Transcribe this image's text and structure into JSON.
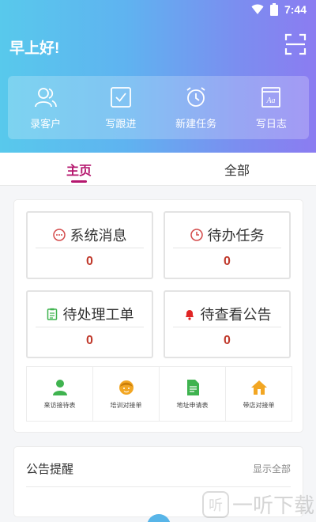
{
  "status_bar": {
    "time": "7:44"
  },
  "header": {
    "greeting": "早上好!"
  },
  "quick_actions": [
    {
      "label": "录客户",
      "icon": "user-group-icon"
    },
    {
      "label": "写跟进",
      "icon": "checkbox-icon"
    },
    {
      "label": "新建任务",
      "icon": "alarm-clock-icon"
    },
    {
      "label": "写日志",
      "icon": "notebook-icon"
    }
  ],
  "tabs": [
    {
      "label": "主页",
      "active": true
    },
    {
      "label": "全部",
      "active": false
    }
  ],
  "stats": [
    {
      "title": "系统消息",
      "value": "0",
      "icon": "message-icon",
      "color": "#d44b4b"
    },
    {
      "title": "待办任务",
      "value": "0",
      "icon": "clock-icon",
      "color": "#d44b4b"
    },
    {
      "title": "待处理工单",
      "value": "0",
      "icon": "clipboard-icon",
      "color": "#3fb34f"
    },
    {
      "title": "待查看公告",
      "value": "0",
      "icon": "bell-icon",
      "color": "#e02424"
    }
  ],
  "forms": [
    {
      "label": "来访接待表",
      "icon": "person-icon",
      "color": "#3fb34f"
    },
    {
      "label": "培训对接单",
      "icon": "face-icon",
      "color": "#f2a623"
    },
    {
      "label": "地址申请表",
      "icon": "document-icon",
      "color": "#3fb34f"
    },
    {
      "label": "带店对接单",
      "icon": "home-icon",
      "color": "#f2a623"
    }
  ],
  "notice": {
    "title": "公告提醒",
    "show_all": "显示全部"
  },
  "watermark": {
    "text": "一听下载",
    "logo": "听"
  }
}
